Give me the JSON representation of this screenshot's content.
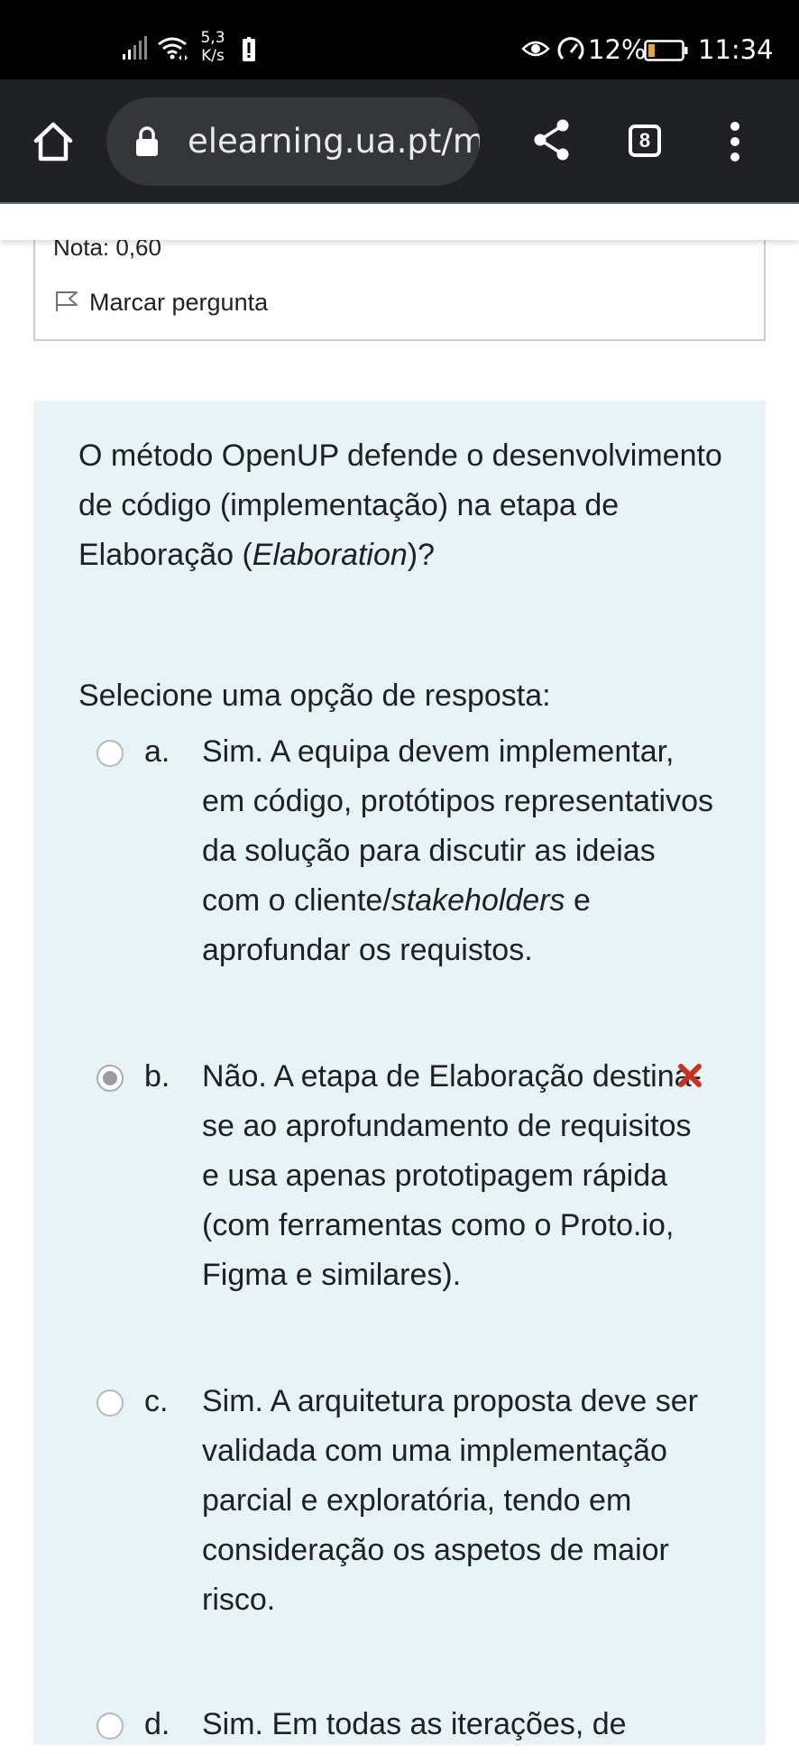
{
  "status_bar": {
    "network_speed_value": "5,3",
    "network_speed_unit": "K/s",
    "battery_percent": "12%",
    "time": "11:34",
    "icons": [
      "signal-icon",
      "wifi-icon",
      "alert-icon",
      "eye-icon",
      "power-saver-icon",
      "battery-icon"
    ],
    "battery_color": "#f5a623"
  },
  "browser": {
    "url": "elearning.ua.pt/mod/quiz/attempt.php",
    "tab_count": "8",
    "icons": [
      "home-icon",
      "lock-icon",
      "share-icon",
      "tab-switcher-icon",
      "more-menu-icon"
    ]
  },
  "previous_question": {
    "grade": "Nota: 0,60",
    "flag_label": "Marcar pergunta"
  },
  "question": {
    "text_part1": "O método OpenUP defende o desenvolvimento de código (implementação) na etapa de Elaboração (",
    "text_em": "Elaboration",
    "text_part2": ")?",
    "prompt": "Selecione uma opção de resposta:",
    "card_color": "#e7f3f5",
    "options": [
      {
        "letter": "a.",
        "text_part1": "Sim. A equipa devem implementar, em código, protótipos representativos da solução para discutir as ideias com o cliente/",
        "text_em": "stakeholders",
        "text_part2": " e aprofundar os requistos.",
        "selected": false
      },
      {
        "letter": "b.",
        "text": "Não. A etapa de Elaboração destina-se ao aprofundamento de requisitos e usa apenas prototipagem rápida (com ferramentas como o Proto.io, Figma e similares).",
        "selected": true,
        "feedback": "incorrect",
        "feedback_color": "#ca3120"
      },
      {
        "letter": "c.",
        "text": "Sim. A arquitetura proposta deve ser validada com uma implementação parcial e exploratória, tendo em consideração os aspetos de maior risco.",
        "selected": false
      },
      {
        "letter": "d.",
        "text": "Sim. Em todas as iterações, de",
        "selected": false
      }
    ]
  }
}
